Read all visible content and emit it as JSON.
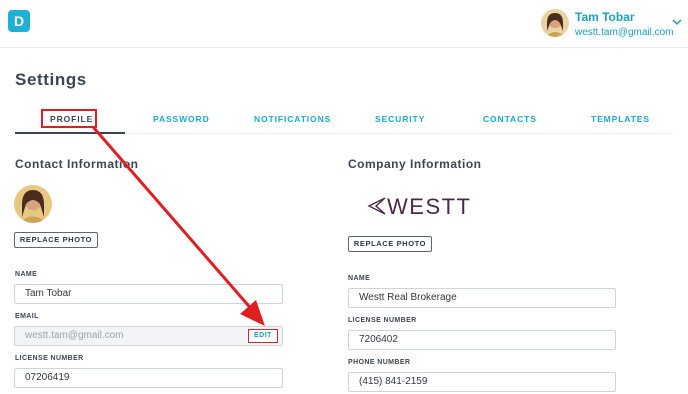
{
  "header": {
    "logo_letter": "D",
    "user_name": "Tam Tobar",
    "user_email": "westt.tam@gmail.com"
  },
  "page_title": "Settings",
  "tabs": [
    {
      "label": "PROFILE",
      "active": true
    },
    {
      "label": "PASSWORD",
      "active": false
    },
    {
      "label": "NOTIFICATIONS",
      "active": false
    },
    {
      "label": "SECURITY",
      "active": false
    },
    {
      "label": "CONTACTS",
      "active": false
    },
    {
      "label": "TEMPLATES",
      "active": false
    }
  ],
  "contact": {
    "title": "Contact Information",
    "replace_photo_label": "REPLACE PHOTO",
    "name_label": "NAME",
    "name_value": "Tam Tobar",
    "email_label": "EMAIL",
    "email_placeholder": "westt.tam@gmail.com",
    "edit_label": "EDIT",
    "license_label": "LICENSE NUMBER",
    "license_value": "07206419"
  },
  "company": {
    "title": "Company Information",
    "logo_text": "WESTT",
    "replace_photo_label": "REPLACE PHOTO",
    "name_label": "NAME",
    "name_value": "Westt Real Brokerage",
    "license_label": "LICENSE NUMBER",
    "license_value": "7206402",
    "phone_label": "PHONE NUMBER",
    "phone_value": "(415) 841-2159"
  },
  "colors": {
    "accent": "#1aaad0",
    "annotation": "#e02020",
    "heading": "#3c4653"
  }
}
